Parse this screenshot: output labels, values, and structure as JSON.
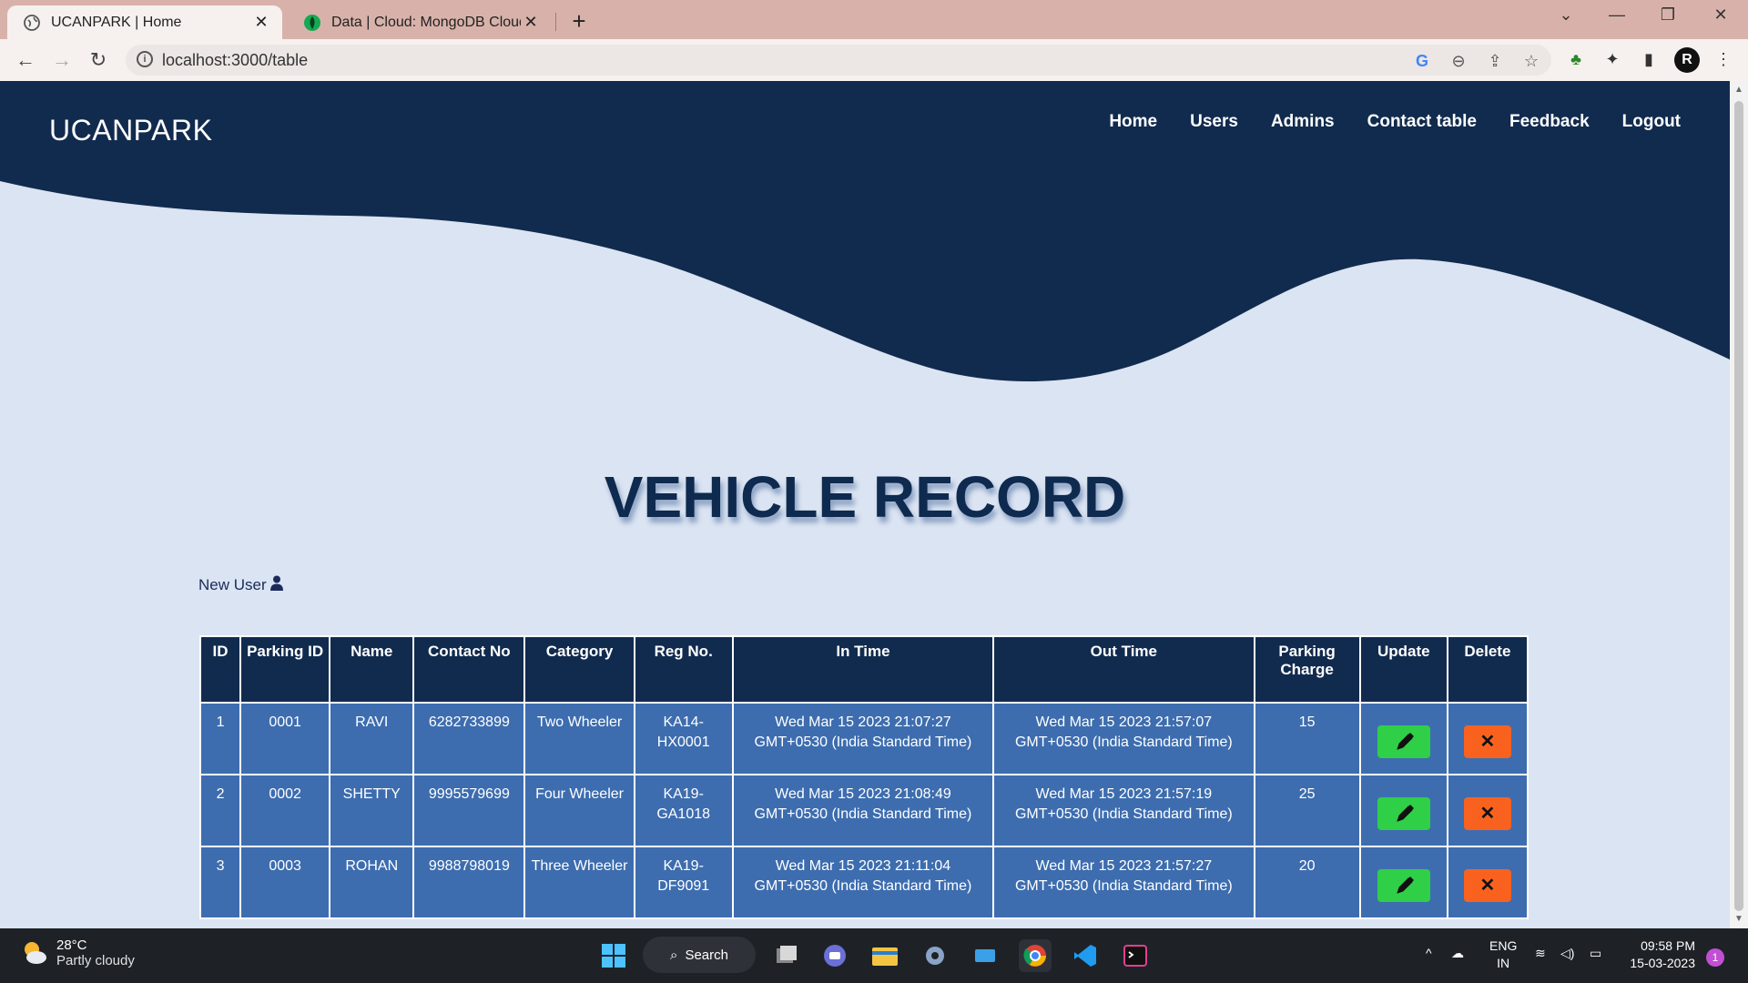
{
  "browser": {
    "tabs": [
      {
        "label": "UCANPARK | Home",
        "active": true
      },
      {
        "label": "Data | Cloud: MongoDB Cloud",
        "active": false
      }
    ],
    "url": "localhost:3000/table"
  },
  "site": {
    "brand": "UCANPARK",
    "nav": [
      "Home",
      "Users",
      "Admins",
      "Contact table",
      "Feedback",
      "Logout"
    ],
    "title": "VEHICLE RECORD",
    "new_user_label": "New User"
  },
  "table": {
    "headers": [
      "ID",
      "Parking ID",
      "Name",
      "Contact No",
      "Category",
      "Reg No.",
      "In Time",
      "Out Time",
      "Parking Charge",
      "Update",
      "Delete"
    ],
    "rows": [
      {
        "id": "1",
        "parking_id": "0001",
        "name": "RAVI",
        "contact": "6282733899",
        "category": "Two Wheeler",
        "reg": "KA14-HX0001",
        "in_time": "Wed Mar 15 2023 21:07:27 GMT+0530 (India Standard Time)",
        "out_time": "Wed Mar 15 2023 21:57:07 GMT+0530 (India Standard Time)",
        "charge": "15"
      },
      {
        "id": "2",
        "parking_id": "0002",
        "name": "SHETTY",
        "contact": "9995579699",
        "category": "Four Wheeler",
        "reg": "KA19-GA1018",
        "in_time": "Wed Mar 15 2023 21:08:49 GMT+0530 (India Standard Time)",
        "out_time": "Wed Mar 15 2023 21:57:19 GMT+0530 (India Standard Time)",
        "charge": "25"
      },
      {
        "id": "3",
        "parking_id": "0003",
        "name": "ROHAN",
        "contact": "9988798019",
        "category": "Three Wheeler",
        "reg": "KA19-DF9091",
        "in_time": "Wed Mar 15 2023 21:11:04 GMT+0530 (India Standard Time)",
        "out_time": "Wed Mar 15 2023 21:57:27 GMT+0530 (India Standard Time)",
        "charge": "20"
      }
    ],
    "delete_symbol": "✕"
  },
  "taskbar": {
    "weather_temp": "28°C",
    "weather_cond": "Partly cloudy",
    "search_label": "Search",
    "lang_top": "ENG",
    "lang_bottom": "IN",
    "time": "09:58 PM",
    "date": "15-03-2023",
    "notification_count": "1"
  },
  "colors": {
    "navy": "#112b4e",
    "cell_blue": "#3d6daf",
    "page_bg": "#dbe4f2",
    "edit_green": "#2fcf48",
    "delete_orange": "#f9621e"
  }
}
